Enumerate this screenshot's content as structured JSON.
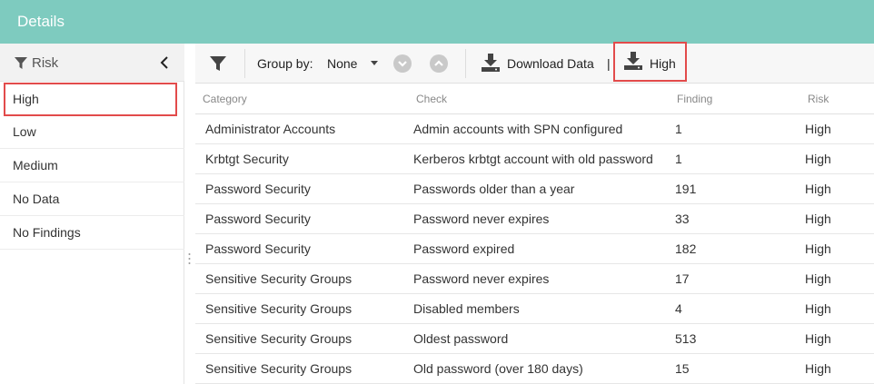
{
  "header": {
    "title": "Details"
  },
  "left_panel": {
    "title": "Risk",
    "icons": {
      "filter": "filter-icon",
      "collapse": "chevron-left-icon"
    },
    "items": [
      {
        "label": "High",
        "selected": true
      },
      {
        "label": "Low",
        "selected": false
      },
      {
        "label": "Medium",
        "selected": false
      },
      {
        "label": "No Data",
        "selected": false
      },
      {
        "label": "No Findings",
        "selected": false
      }
    ]
  },
  "toolbar": {
    "group_by_label": "Group by:",
    "group_by_value": "None",
    "download_label": "Download Data",
    "separator": "|",
    "high_label": "High"
  },
  "table": {
    "columns": [
      "Category",
      "Check",
      "Finding",
      "Risk"
    ],
    "rows": [
      [
        "Administrator Accounts",
        "Admin accounts with SPN configured",
        "1",
        "High"
      ],
      [
        "Krbtgt Security",
        "Kerberos krbtgt account with old password",
        "1",
        "High"
      ],
      [
        "Password Security",
        "Passwords older than a year",
        "191",
        "High"
      ],
      [
        "Password Security",
        "Password never expires",
        "33",
        "High"
      ],
      [
        "Password Security",
        "Password expired",
        "182",
        "High"
      ],
      [
        "Sensitive Security Groups",
        "Password never expires",
        "17",
        "High"
      ],
      [
        "Sensitive Security Groups",
        "Disabled members",
        "4",
        "High"
      ],
      [
        "Sensitive Security Groups",
        "Oldest password",
        "513",
        "High"
      ],
      [
        "Sensitive Security Groups",
        "Old password (over 180 days)",
        "15",
        "High"
      ]
    ]
  },
  "colors": {
    "header": "#7ecbbf",
    "highlight": "#e24b4b"
  }
}
